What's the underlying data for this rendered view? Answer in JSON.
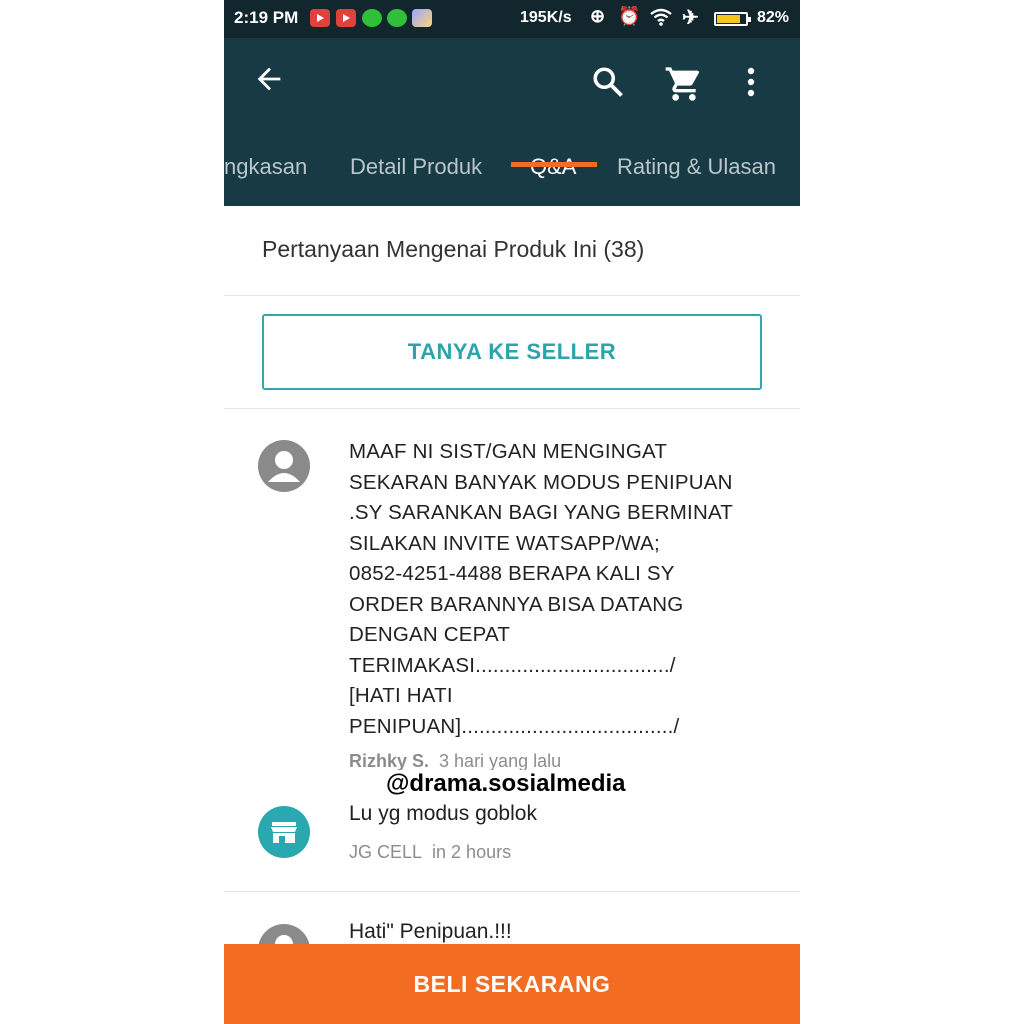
{
  "status_bar": {
    "time": "2:19 PM",
    "net_speed": "195K/s",
    "battery_percent": "82%",
    "battery_level": 0.82,
    "icons": [
      "youtube-icon",
      "youtube-icon",
      "line-icon",
      "line-icon",
      "gallery-icon",
      "sync-icon",
      "alarm-icon",
      "wifi-icon",
      "airplane-icon",
      "battery-icon"
    ]
  },
  "toolbar": {
    "icons": [
      "back-arrow-icon",
      "search-icon",
      "cart-icon",
      "more-vert-icon"
    ],
    "tabs": [
      {
        "label": "ngkasan",
        "active": false
      },
      {
        "label": "Detail Produk",
        "active": false
      },
      {
        "label": "Q&A",
        "active": true
      },
      {
        "label": "Rating & Ulasan",
        "active": false
      }
    ],
    "accent": "#f26c22",
    "background": "#173a44"
  },
  "qa": {
    "header": "Pertanyaan Mengenai Produk Ini (38)",
    "ask_button": "TANYA KE SELLER",
    "question": {
      "text": "MAAF NI SIST/GAN MENGINGAT\nSEKARAN BANYAK MODUS PENIPUAN\n.SY SARANKAN BAGI YANG BERMINAT\nSILAKAN INVITE WATSAPP/WA;\n0852-4251-4488 BERAPA KALI SY\nORDER BARANNYA BISA DATANG\nDENGAN CEPAT\nTERIMAKASI................................./\n[HATI HATI\nPENIPUAN]..................................../",
      "author": "Rizhky S.",
      "time": "3 hari yang lalu"
    },
    "reply": {
      "text": "Lu yg modus goblok",
      "author": "JG CELL",
      "time": "in 2 hours"
    },
    "next_question": {
      "text": "Hati\" Penipuan.!!!"
    }
  },
  "watermark": "@drama.sosialmedia",
  "buy_button": "BELI SEKARANG"
}
